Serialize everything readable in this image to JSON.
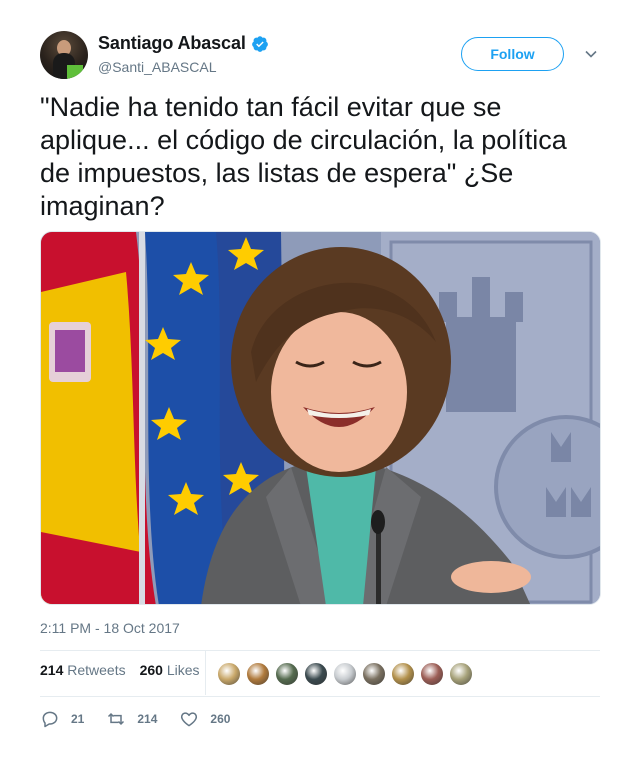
{
  "author": {
    "name": "Santiago Abascal",
    "handle": "@Santi_ABASCAL",
    "verified": true,
    "avatar_icon": "profile-photo"
  },
  "follow_label": "Follow",
  "tweet_text": "\"Nadie ha tenido tan fácil evitar que se aplique... el código de circulación, la política de impuestos, las listas de espera\" ¿Se imaginan?",
  "media": {
    "type": "photo"
  },
  "timestamp": "2:11 PM - 18 Oct 2017",
  "stats": {
    "retweets_count": "214",
    "retweets_label": "Retweets",
    "likes_count": "260",
    "likes_label": "Likes"
  },
  "likers": [
    {
      "color": "#c9a86a"
    },
    {
      "color": "#b07a3c"
    },
    {
      "color": "#556b4f"
    },
    {
      "color": "#3b4a4f"
    },
    {
      "color": "#c8ccd0"
    },
    {
      "color": "#7a7060"
    },
    {
      "color": "#b3914c"
    },
    {
      "color": "#9c5e56"
    },
    {
      "color": "#a7a27a"
    }
  ],
  "actions": {
    "reply_count": "21",
    "retweet_count": "214",
    "like_count": "260"
  },
  "colors": {
    "accent": "#1da1f2",
    "text": "#14171a",
    "muted": "#657786"
  }
}
